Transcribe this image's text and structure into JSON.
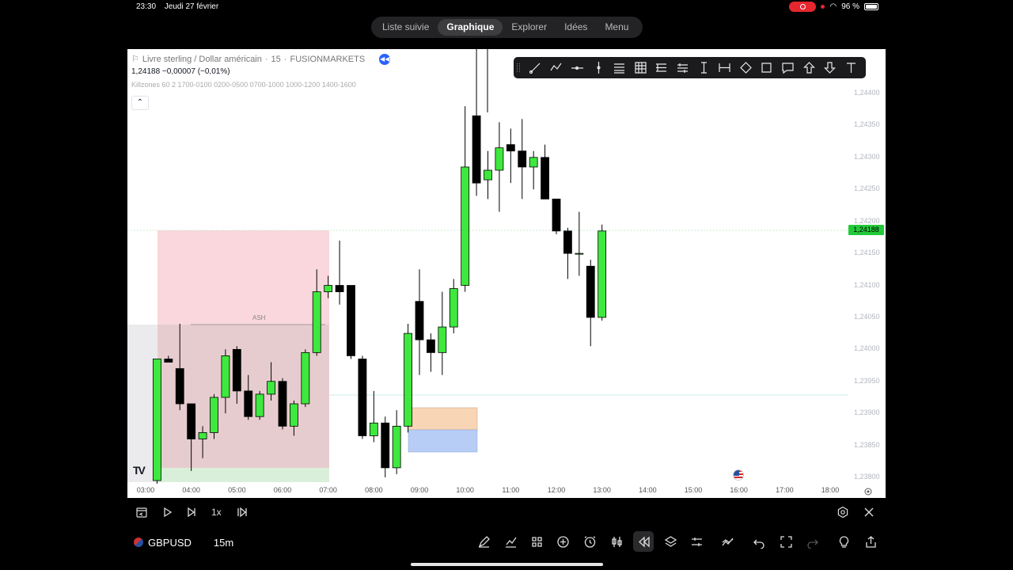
{
  "status": {
    "time": "23:30",
    "date": "Jeudi 27 février",
    "battery": "96 %"
  },
  "tabs": [
    {
      "label": "Liste suivie",
      "active": false
    },
    {
      "label": "Graphique",
      "active": true
    },
    {
      "label": "Explorer",
      "active": false
    },
    {
      "label": "Idées",
      "active": false
    },
    {
      "label": "Menu",
      "active": false
    }
  ],
  "legend": {
    "title": "Livre sterling / Dollar américain",
    "interval": "15",
    "exchange": "FUSIONMARKETS",
    "price_line": "1,24188  −0,00007 (−0,01%)",
    "indicator": "Killzones 60 2 1700-0100 0200-0500 0700-1000 1000-1200 1400-1600"
  },
  "drawing_tools": [
    "trend-line-icon",
    "zigzag-icon",
    "horizontal-line-icon",
    "vertical-line-icon",
    "parallel-channel-icon",
    "grid-icon",
    "fib-icon",
    "lines-icon",
    "measure-icon",
    "range-icon",
    "diamond-icon",
    "rectangle-icon",
    "comment-icon",
    "arrow-up-icon",
    "arrow-down-icon",
    "text-icon"
  ],
  "chart_data": {
    "type": "candlestick",
    "symbol": "GBPUSD",
    "current_price": "1,24188",
    "ylabels": [
      "1,24400",
      "1,24350",
      "1,24300",
      "1,24250",
      "1,24200",
      "1,24150",
      "1,24100",
      "1,24050",
      "1,24000",
      "1,23950",
      "1,23900",
      "1,23850",
      "1,23800"
    ],
    "yvalues": [
      1.244,
      1.2435,
      1.243,
      1.2425,
      1.242,
      1.2415,
      1.241,
      1.2405,
      1.24,
      1.2395,
      1.239,
      1.2385,
      1.238
    ],
    "xlabels": [
      "03:00",
      "04:00",
      "05:00",
      "06:00",
      "07:00",
      "08:00",
      "09:00",
      "10:00",
      "11:00",
      "12:00",
      "13:00",
      "14:00",
      "15:00",
      "16:00",
      "17:00",
      "18:00"
    ],
    "annotation": "ASH",
    "candles": [
      {
        "t": "03:15",
        "o": 1.23795,
        "h": 1.23895,
        "l": 1.2379,
        "c": 1.23985
      },
      {
        "t": "03:30",
        "o": 1.23985,
        "h": 1.2399,
        "l": 1.2398,
        "c": 1.2398
      },
      {
        "t": "03:45",
        "o": 1.2397,
        "h": 1.2404,
        "l": 1.23905,
        "c": 1.23915
      },
      {
        "t": "04:00",
        "o": 1.23915,
        "h": 1.23915,
        "l": 1.2381,
        "c": 1.2386
      },
      {
        "t": "04:15",
        "o": 1.2386,
        "h": 1.2388,
        "l": 1.2383,
        "c": 1.2387
      },
      {
        "t": "04:30",
        "o": 1.2387,
        "h": 1.2393,
        "l": 1.2386,
        "c": 1.23925
      },
      {
        "t": "04:45",
        "o": 1.23925,
        "h": 1.24,
        "l": 1.239,
        "c": 1.2399
      },
      {
        "t": "05:00",
        "o": 1.24,
        "h": 1.24005,
        "l": 1.23915,
        "c": 1.23935
      },
      {
        "t": "05:15",
        "o": 1.23935,
        "h": 1.2396,
        "l": 1.2389,
        "c": 1.23895
      },
      {
        "t": "05:30",
        "o": 1.23895,
        "h": 1.23935,
        "l": 1.2389,
        "c": 1.2393
      },
      {
        "t": "05:45",
        "o": 1.2393,
        "h": 1.2398,
        "l": 1.2392,
        "c": 1.2395
      },
      {
        "t": "06:00",
        "o": 1.2395,
        "h": 1.23955,
        "l": 1.23875,
        "c": 1.2388
      },
      {
        "t": "06:15",
        "o": 1.2388,
        "h": 1.2392,
        "l": 1.23865,
        "c": 1.23915
      },
      {
        "t": "06:30",
        "o": 1.23915,
        "h": 1.24,
        "l": 1.2391,
        "c": 1.23995
      },
      {
        "t": "06:45",
        "o": 1.23995,
        "h": 1.24125,
        "l": 1.2399,
        "c": 1.2409
      },
      {
        "t": "07:00",
        "o": 1.2409,
        "h": 1.24115,
        "l": 1.2408,
        "c": 1.241
      },
      {
        "t": "07:15",
        "o": 1.241,
        "h": 1.2417,
        "l": 1.2407,
        "c": 1.2409
      },
      {
        "t": "07:30",
        "o": 1.241,
        "h": 1.241,
        "l": 1.23985,
        "c": 1.2399
      },
      {
        "t": "07:45",
        "o": 1.23985,
        "h": 1.2399,
        "l": 1.2386,
        "c": 1.23865
      },
      {
        "t": "08:00",
        "o": 1.23865,
        "h": 1.23935,
        "l": 1.23855,
        "c": 1.23885
      },
      {
        "t": "08:15",
        "o": 1.23885,
        "h": 1.23895,
        "l": 1.238,
        "c": 1.23815
      },
      {
        "t": "08:30",
        "o": 1.23815,
        "h": 1.23905,
        "l": 1.23805,
        "c": 1.2388
      },
      {
        "t": "08:45",
        "o": 1.2388,
        "h": 1.2404,
        "l": 1.2387,
        "c": 1.24025
      },
      {
        "t": "09:00",
        "o": 1.24075,
        "h": 1.24125,
        "l": 1.2396,
        "c": 1.24015
      },
      {
        "t": "09:15",
        "o": 1.24015,
        "h": 1.24025,
        "l": 1.23965,
        "c": 1.23995
      },
      {
        "t": "09:30",
        "o": 1.23995,
        "h": 1.2409,
        "l": 1.2396,
        "c": 1.24035
      },
      {
        "t": "09:45",
        "o": 1.24035,
        "h": 1.2411,
        "l": 1.24025,
        "c": 1.24095
      },
      {
        "t": "10:00",
        "o": 1.241,
        "h": 1.2438,
        "l": 1.2409,
        "c": 1.24285
      },
      {
        "t": "10:15",
        "o": 1.24365,
        "h": 1.2454,
        "l": 1.2424,
        "c": 1.2426
      },
      {
        "t": "10:30",
        "o": 1.24265,
        "h": 1.2431,
        "l": 1.24235,
        "c": 1.2428
      },
      {
        "t": "10:45",
        "o": 1.2428,
        "h": 1.24355,
        "l": 1.24215,
        "c": 1.24315
      },
      {
        "t": "11:00",
        "o": 1.2432,
        "h": 1.24345,
        "l": 1.2426,
        "c": 1.2431
      },
      {
        "t": "11:15",
        "o": 1.2431,
        "h": 1.2436,
        "l": 1.24235,
        "c": 1.24285
      },
      {
        "t": "11:30",
        "o": 1.24285,
        "h": 1.2431,
        "l": 1.2425,
        "c": 1.243
      },
      {
        "t": "11:45",
        "o": 1.243,
        "h": 1.2432,
        "l": 1.2424,
        "c": 1.24235
      },
      {
        "t": "12:00",
        "o": 1.24235,
        "h": 1.24235,
        "l": 1.2418,
        "c": 1.24185
      },
      {
        "t": "12:15",
        "o": 1.24185,
        "h": 1.2419,
        "l": 1.2411,
        "c": 1.2415
      },
      {
        "t": "12:30",
        "o": 1.2415,
        "h": 1.24215,
        "l": 1.24115,
        "c": 1.2415
      },
      {
        "t": "12:45",
        "o": 1.2413,
        "h": 1.2414,
        "l": 1.24005,
        "c": 1.2405
      },
      {
        "t": "13:00",
        "o": 1.2405,
        "h": 1.24195,
        "l": 1.24045,
        "c": 1.24185
      }
    ]
  },
  "replay": {
    "speed": "1x"
  },
  "bottom": {
    "symbol": "GBPUSD",
    "interval": "15m"
  }
}
